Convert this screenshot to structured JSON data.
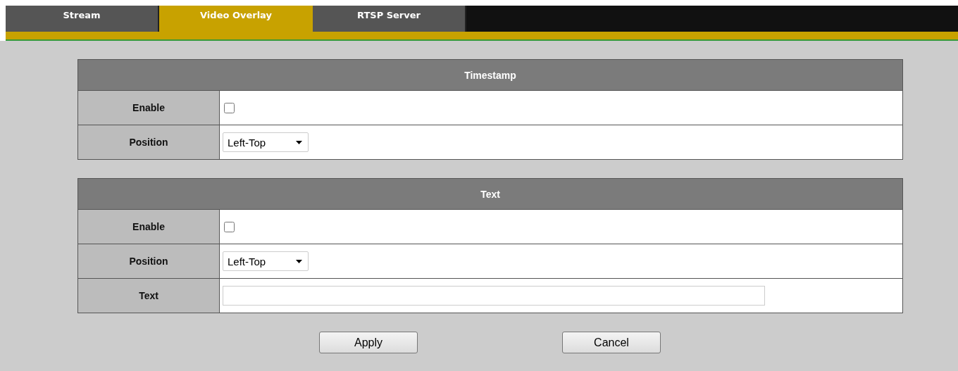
{
  "tabs": [
    {
      "label": "Stream",
      "selected": false
    },
    {
      "label": "Video Overlay",
      "selected": true
    },
    {
      "label": "RTSP Server",
      "selected": false
    }
  ],
  "sections": [
    {
      "title": "Timestamp",
      "rows": [
        {
          "label": "Enable",
          "kind": "checkbox",
          "checked": false
        },
        {
          "label": "Position",
          "kind": "select",
          "value": "Left-Top"
        }
      ]
    },
    {
      "title": "Text",
      "rows": [
        {
          "label": "Enable",
          "kind": "checkbox",
          "checked": false
        },
        {
          "label": "Position",
          "kind": "select",
          "value": "Left-Top"
        },
        {
          "label": "Text",
          "kind": "text"
        }
      ]
    }
  ],
  "buttons": [
    "Apply",
    "Cancel"
  ]
}
